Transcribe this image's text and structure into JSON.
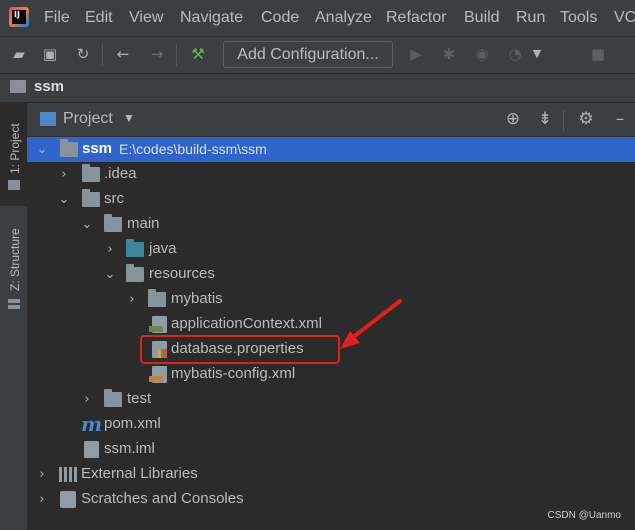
{
  "menubar": {
    "items": [
      "File",
      "Edit",
      "View",
      "Navigate",
      "Code",
      "Analyze",
      "Refactor",
      "Build",
      "Run",
      "Tools",
      "VC"
    ]
  },
  "toolbar": {
    "add_configuration_label": "Add Configuration...",
    "icons": [
      "open-folder-icon",
      "save-icon",
      "sync-icon",
      "back-arrow-icon",
      "forward-arrow-icon",
      "build-hammer-icon",
      "run-icon",
      "debug-icon",
      "coverage-icon",
      "profile-icon",
      "stop-icon"
    ]
  },
  "navbar": {
    "breadcrumb": "ssm"
  },
  "left_strip": {
    "project_tab": "1: Project",
    "structure_tab": "Z: Structure"
  },
  "project_panel": {
    "view_label": "Project"
  },
  "tree": {
    "root_name": "ssm",
    "root_path": "E:\\codes\\build-ssm\\ssm",
    "idea": ".idea",
    "src": "src",
    "main": "main",
    "java": "java",
    "resources": "resources",
    "mybatis": "mybatis",
    "application_context": "applicationContext.xml",
    "database_properties": "database.properties",
    "mybatis_config": "mybatis-config.xml",
    "test": "test",
    "pom": "pom.xml",
    "iml": "ssm.iml",
    "external_libraries": "External Libraries",
    "scratches": "Scratches and Consoles"
  },
  "annotation": {
    "highlight_color": "#e0211c"
  },
  "watermark": "CSDN @Uanmo",
  "colors": {
    "background": "#2b2b2b",
    "chrome": "#3c3f41",
    "selection": "#2f65ca",
    "text": "#bbbbbb"
  }
}
